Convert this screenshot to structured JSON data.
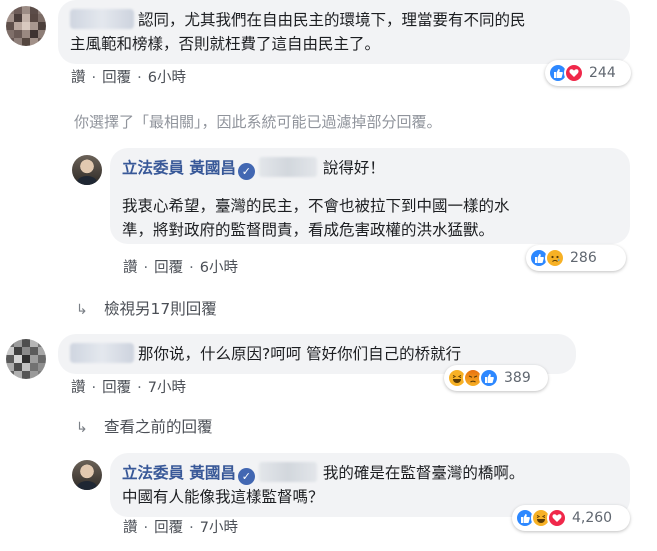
{
  "comments": [
    {
      "text_line1": "認同，尤其我們在自由民主的環境下，理當要有不同的民",
      "text_line2": "主風範和榜樣，否則就枉費了這自由民主了。",
      "actions": {
        "like": "讚",
        "reply": "回覆",
        "time": "6小時"
      },
      "reaction_count": "244",
      "reaction_icons": [
        "like-icon",
        "love-icon"
      ]
    },
    {
      "author": "立法委員 黃國昌",
      "text_line1": "說得好！",
      "text_line2": "我衷心希望，臺灣的民主，不會也被拉下到中國一樣的水",
      "text_line3": "準，將對政府的監督問責，看成危害政權的洪水猛獸。",
      "actions": {
        "like": "讚",
        "reply": "回覆",
        "time": "6小時"
      },
      "reaction_count": "286",
      "reaction_icons": [
        "like-icon",
        "sad-icon"
      ]
    },
    {
      "text_line1": "那你说，什么原因?呵呵 管好你们自己的桥就行",
      "actions": {
        "like": "讚",
        "reply": "回覆",
        "time": "7小時"
      },
      "reaction_count": "389",
      "reaction_icons": [
        "haha-icon",
        "angry-icon",
        "like-icon"
      ]
    },
    {
      "author": "立法委員 黃國昌",
      "text_line1": "我的確是在監督臺灣的橋啊。",
      "text_line2": "中國有人能像我這樣監督嗎？",
      "actions": {
        "like": "讚",
        "reply": "回覆",
        "time": "7小時"
      },
      "reaction_count": "4,260",
      "reaction_icons": [
        "like-icon",
        "haha-icon",
        "love-icon"
      ]
    }
  ],
  "filter_notice": "你選擇了「最相關」，因此系統可能已過濾掉部分回覆。",
  "view_more_replies": "檢視另17則回覆",
  "view_previous_replies": "查看之前的回覆",
  "verified_badge": "✓",
  "separator": "·",
  "colors": {
    "link": "#385898",
    "bubble": "#f2f3f5",
    "meta": "#606770",
    "like": "#2d88ff",
    "love": "#f0284a",
    "haha": "#f7b125"
  }
}
